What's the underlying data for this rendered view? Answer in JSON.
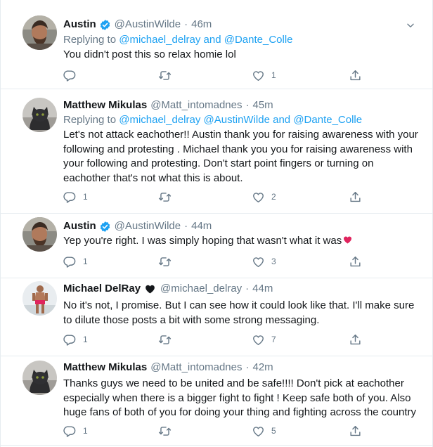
{
  "tweets": [
    {
      "author": "Austin",
      "handle": "@AustinWilde",
      "time": "46m",
      "reply_prefix": "Replying to",
      "reply_mentions": [
        "@michael_delray",
        "and",
        "@Dante_Colle"
      ],
      "lines": [
        "You didn't post this so relax homie lol"
      ],
      "reply_count": "",
      "retweet_count": "",
      "like_count": "1"
    },
    {
      "author": "Matthew Mikulas",
      "handle": "@Matt_intomadnes",
      "time": "45m",
      "reply_prefix": "Replying to",
      "reply_mentions": [
        "@michael_delray",
        "@AustinWilde",
        "and",
        "@Dante_Colle"
      ],
      "lines": [
        "Let's not attack eachother!! Austin thank you for raising awareness with your",
        "following and protesting . Michael thank you you for raising awareness with",
        "your following and protesting. Don't start point fingers or turning  on",
        "eachother that's not what this is about."
      ],
      "reply_count": "1",
      "retweet_count": "",
      "like_count": "2"
    },
    {
      "author": "Austin",
      "handle": "@AustinWilde",
      "time": "44m",
      "lines": [
        "Yep you're right. I was simply hoping that wasn't what it was"
      ],
      "reply_count": "1",
      "retweet_count": "",
      "like_count": "3"
    },
    {
      "author": "Michael DelRay",
      "handle": "@michael_delray",
      "time": "44m",
      "lines": [
        "No it's not, I promise. But I can see how it could look like that. I'll make sure",
        "to dilute those posts a bit with some strong messaging."
      ],
      "reply_count": "1",
      "retweet_count": "",
      "like_count": "7"
    },
    {
      "author": "Matthew Mikulas",
      "handle": "@Matt_intomadnes",
      "time": "42m",
      "lines": [
        "Thanks guys we need to be united and be safe!!!! Don't pick at eachother",
        "especially when there is a bigger fight to fight ! Keep safe both of you. Also",
        "huge fans of both of you for doing your thing and fighting across the country"
      ],
      "reply_count": "1",
      "retweet_count": "",
      "like_count": "5"
    }
  ],
  "separator": "·",
  "colors": {
    "accent": "#1da1f2",
    "muted": "#657786",
    "text": "#14171a",
    "border": "#e6ecf0",
    "heart": "#e0245e"
  },
  "icons": [
    "verified-badge-icon",
    "black-heart-icon",
    "red-heart-icon",
    "chevron-down-icon",
    "reply-icon",
    "retweet-icon",
    "like-icon",
    "share-icon"
  ]
}
